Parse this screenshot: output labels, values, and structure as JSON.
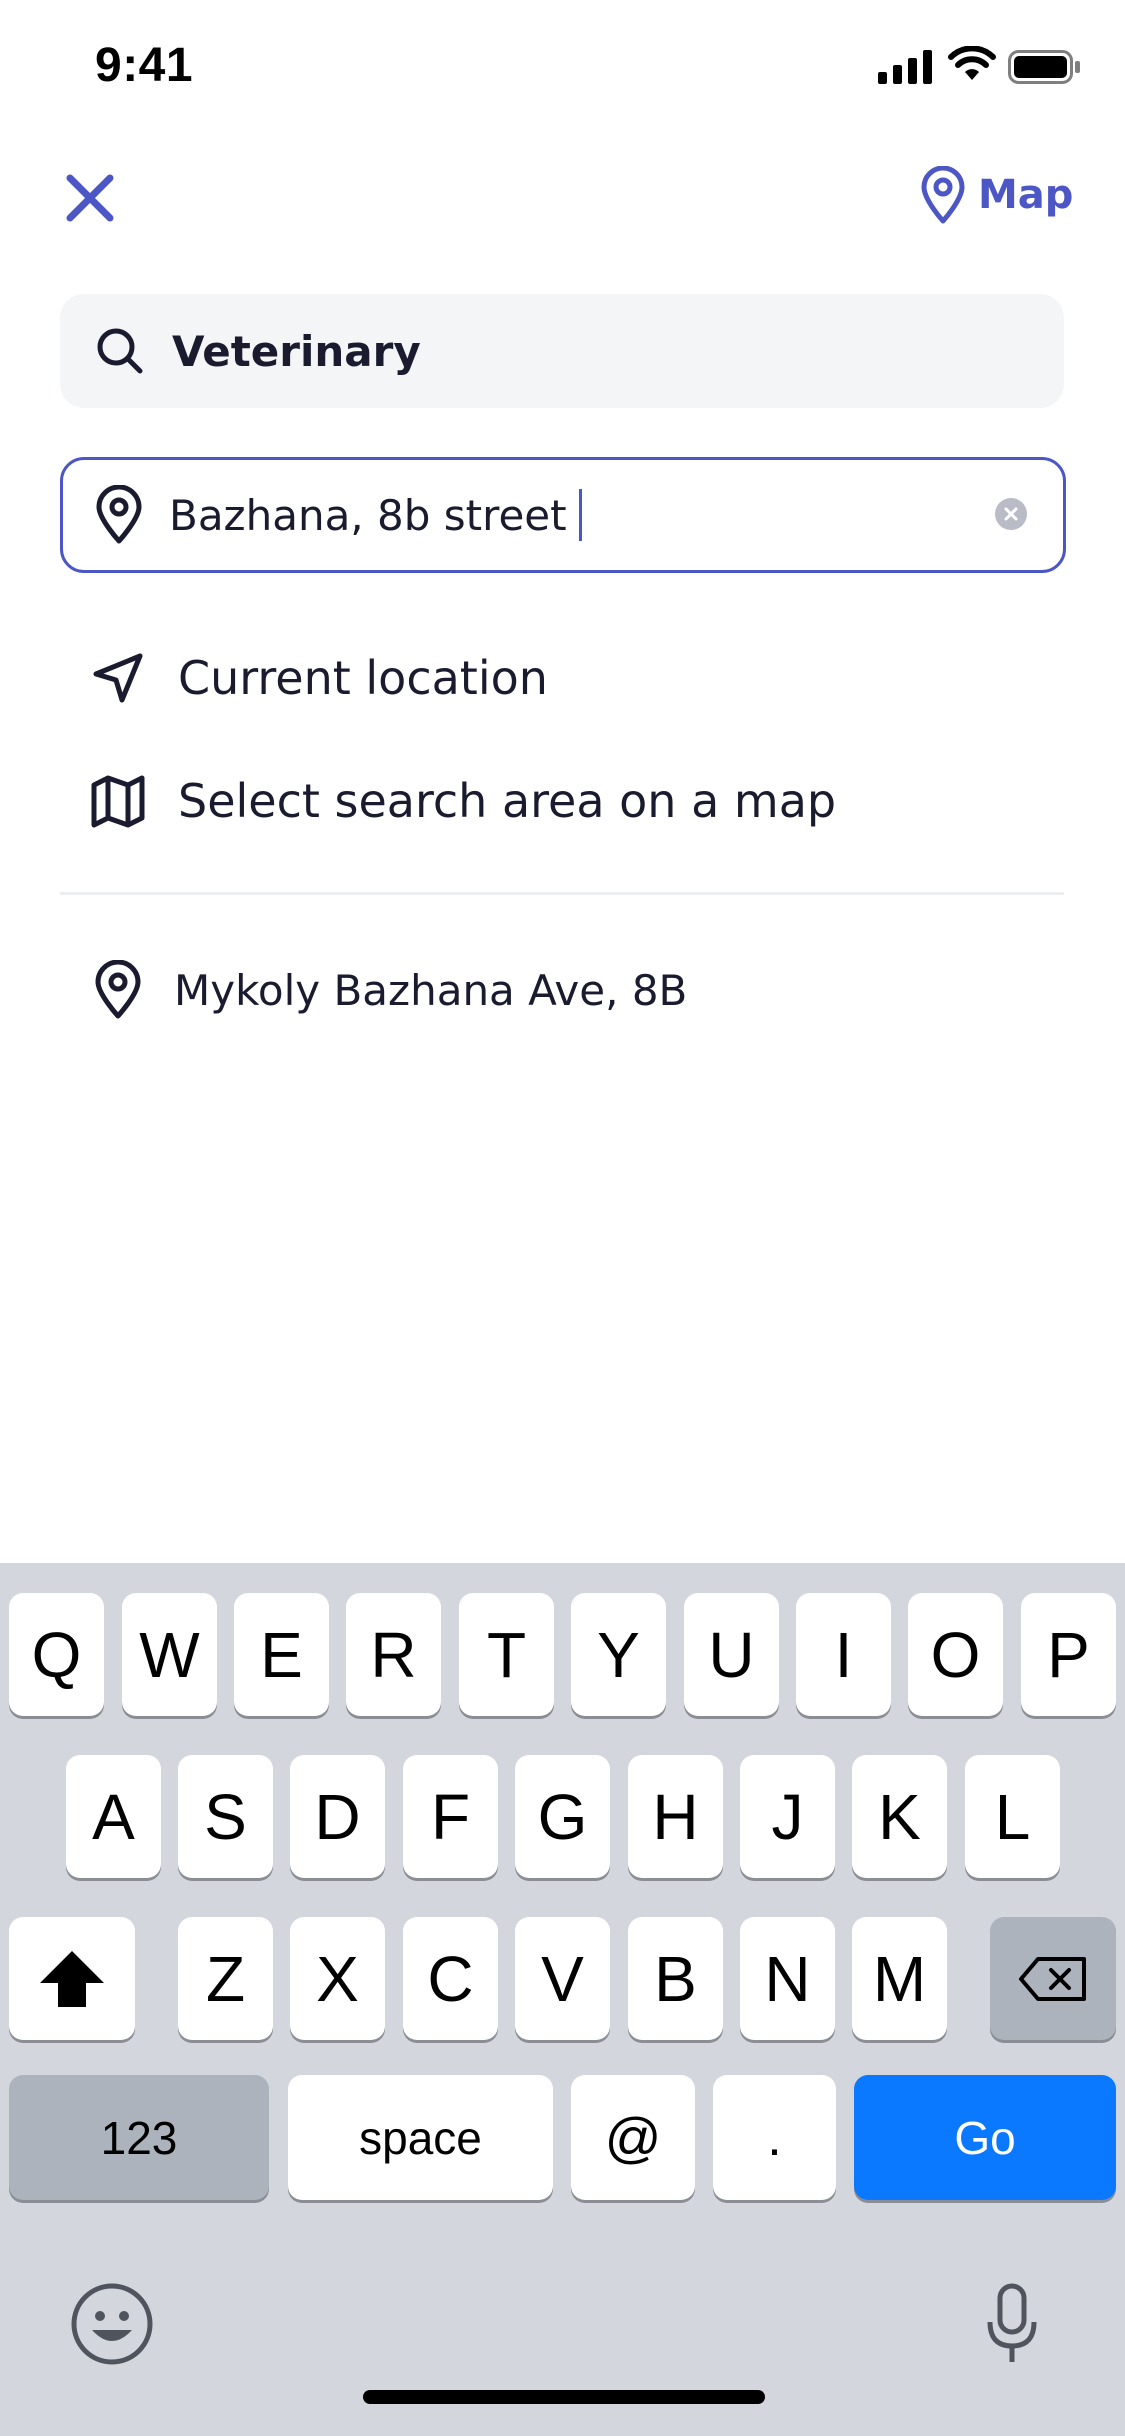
{
  "status_bar": {
    "time": "9:41"
  },
  "nav": {
    "map_label": "Map"
  },
  "search": {
    "query": "Veterinary"
  },
  "location": {
    "value": "Bazhana, 8b street"
  },
  "options": [
    {
      "label": "Current location",
      "icon": "navigation-arrow-icon"
    },
    {
      "label": "Select search area on a map",
      "icon": "map-icon"
    }
  ],
  "suggestions": [
    {
      "label": "Mykoly Bazhana Ave, 8B",
      "icon": "location-pin-icon"
    }
  ],
  "keyboard": {
    "row1": [
      "Q",
      "W",
      "E",
      "R",
      "T",
      "Y",
      "U",
      "I",
      "O",
      "P"
    ],
    "row2": [
      "A",
      "S",
      "D",
      "F",
      "G",
      "H",
      "J",
      "K",
      "L"
    ],
    "row3": [
      "Z",
      "X",
      "C",
      "V",
      "B",
      "N",
      "M"
    ],
    "numbers_label": "123",
    "space_label": "space",
    "at_label": "@",
    "dot_label": ".",
    "go_label": "Go"
  },
  "colors": {
    "accent": "#4c56c4",
    "go_key": "#0a78ff",
    "keyboard_bg": "#d3d6dd"
  }
}
